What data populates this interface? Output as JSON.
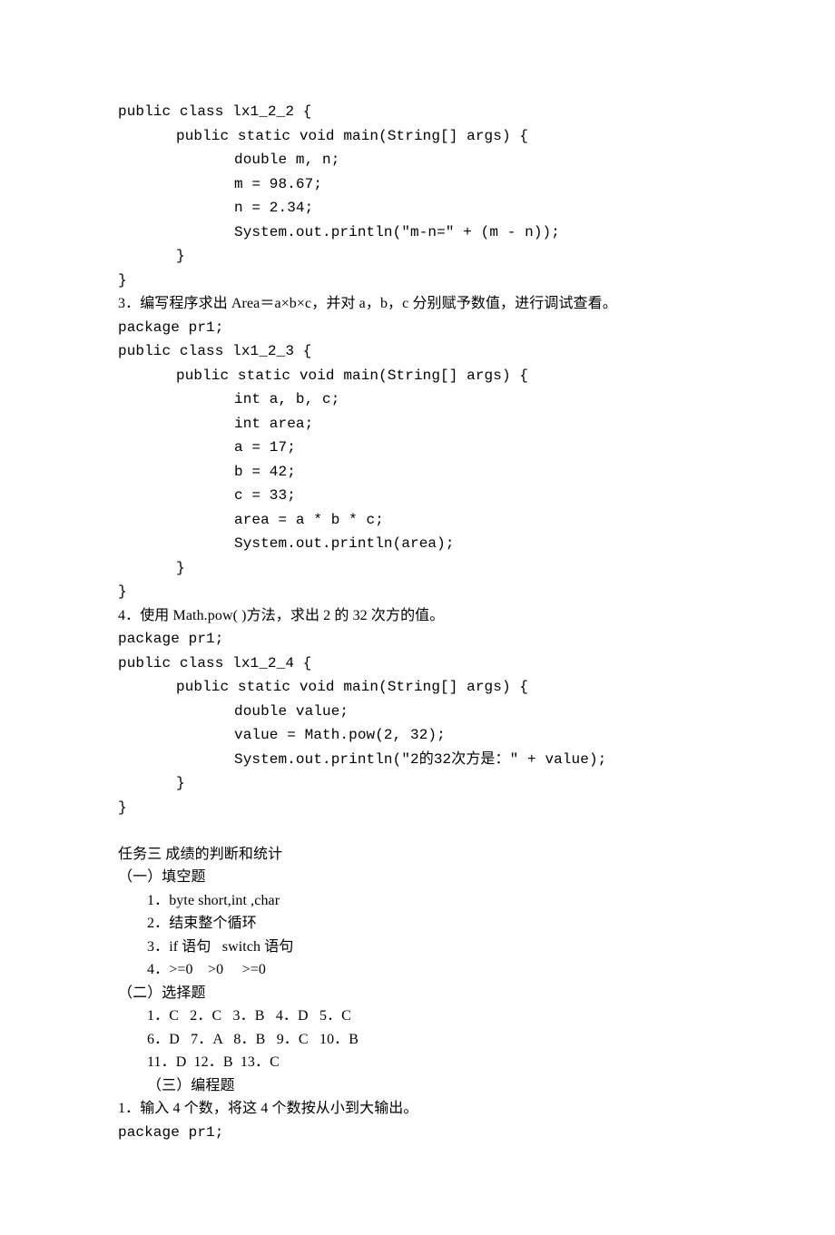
{
  "code1": {
    "l1": "public class lx1_2_2 {",
    "l2": "public static void main(String[] args) {",
    "l3": "double m, n;",
    "l4": "m = 98.67;",
    "l5": "n = 2.34;",
    "l6": "System.out.println(\"m-n=\" + (m - n));",
    "l7": "}",
    "l8": "}"
  },
  "q3": "3．编写程序求出 Area＝a×b×c，并对 a，b，c 分别赋予数值，进行调试查看。",
  "code2": {
    "l0": "package pr1;",
    "l1": "public class lx1_2_3 {",
    "l2": "public static void main(String[] args) {",
    "l3": "int a, b, c;",
    "l4": "int area;",
    "l5": "a = 17;",
    "l6": "b = 42;",
    "l7": "c = 33;",
    "l8": "area = a * b * c;",
    "l9": "System.out.println(area);",
    "l10": "}",
    "l11": "}"
  },
  "q4": "4．使用 Math.pow( )方法，求出 2 的 32 次方的值。",
  "code3": {
    "l0": "package pr1;",
    "l1": "public class lx1_2_4 {",
    "l2": "public static void main(String[] args) {",
    "l3": "double value;",
    "l4": "value = Math.pow(2, 32);",
    "l5": "System.out.println(\"2的32次方是：\" + value);",
    "l6": "}",
    "l7": "}"
  },
  "task3": {
    "title": "任务三 成绩的判断和统计",
    "sec1_title": "（一）填空题",
    "fill": {
      "l1": "1．byte short,int ,char",
      "l2": "2．结束整个循环",
      "l3": "3．if 语句   switch 语句",
      "l4": "4．>=0    >0     >=0"
    },
    "sec2_title": "（二）选择题",
    "choice": {
      "l1": "1．C   2．C   3．B   4．D   5．C",
      "l2": "6．D   7．A   8．B   9．C   10．B",
      "l3": "11．D  12．B  13．C"
    },
    "sec3_title": "（三）编程题",
    "prog1": "1．输入 4 个数，将这 4 个数按从小到大输出。",
    "code_pkg": "package pr1;"
  }
}
